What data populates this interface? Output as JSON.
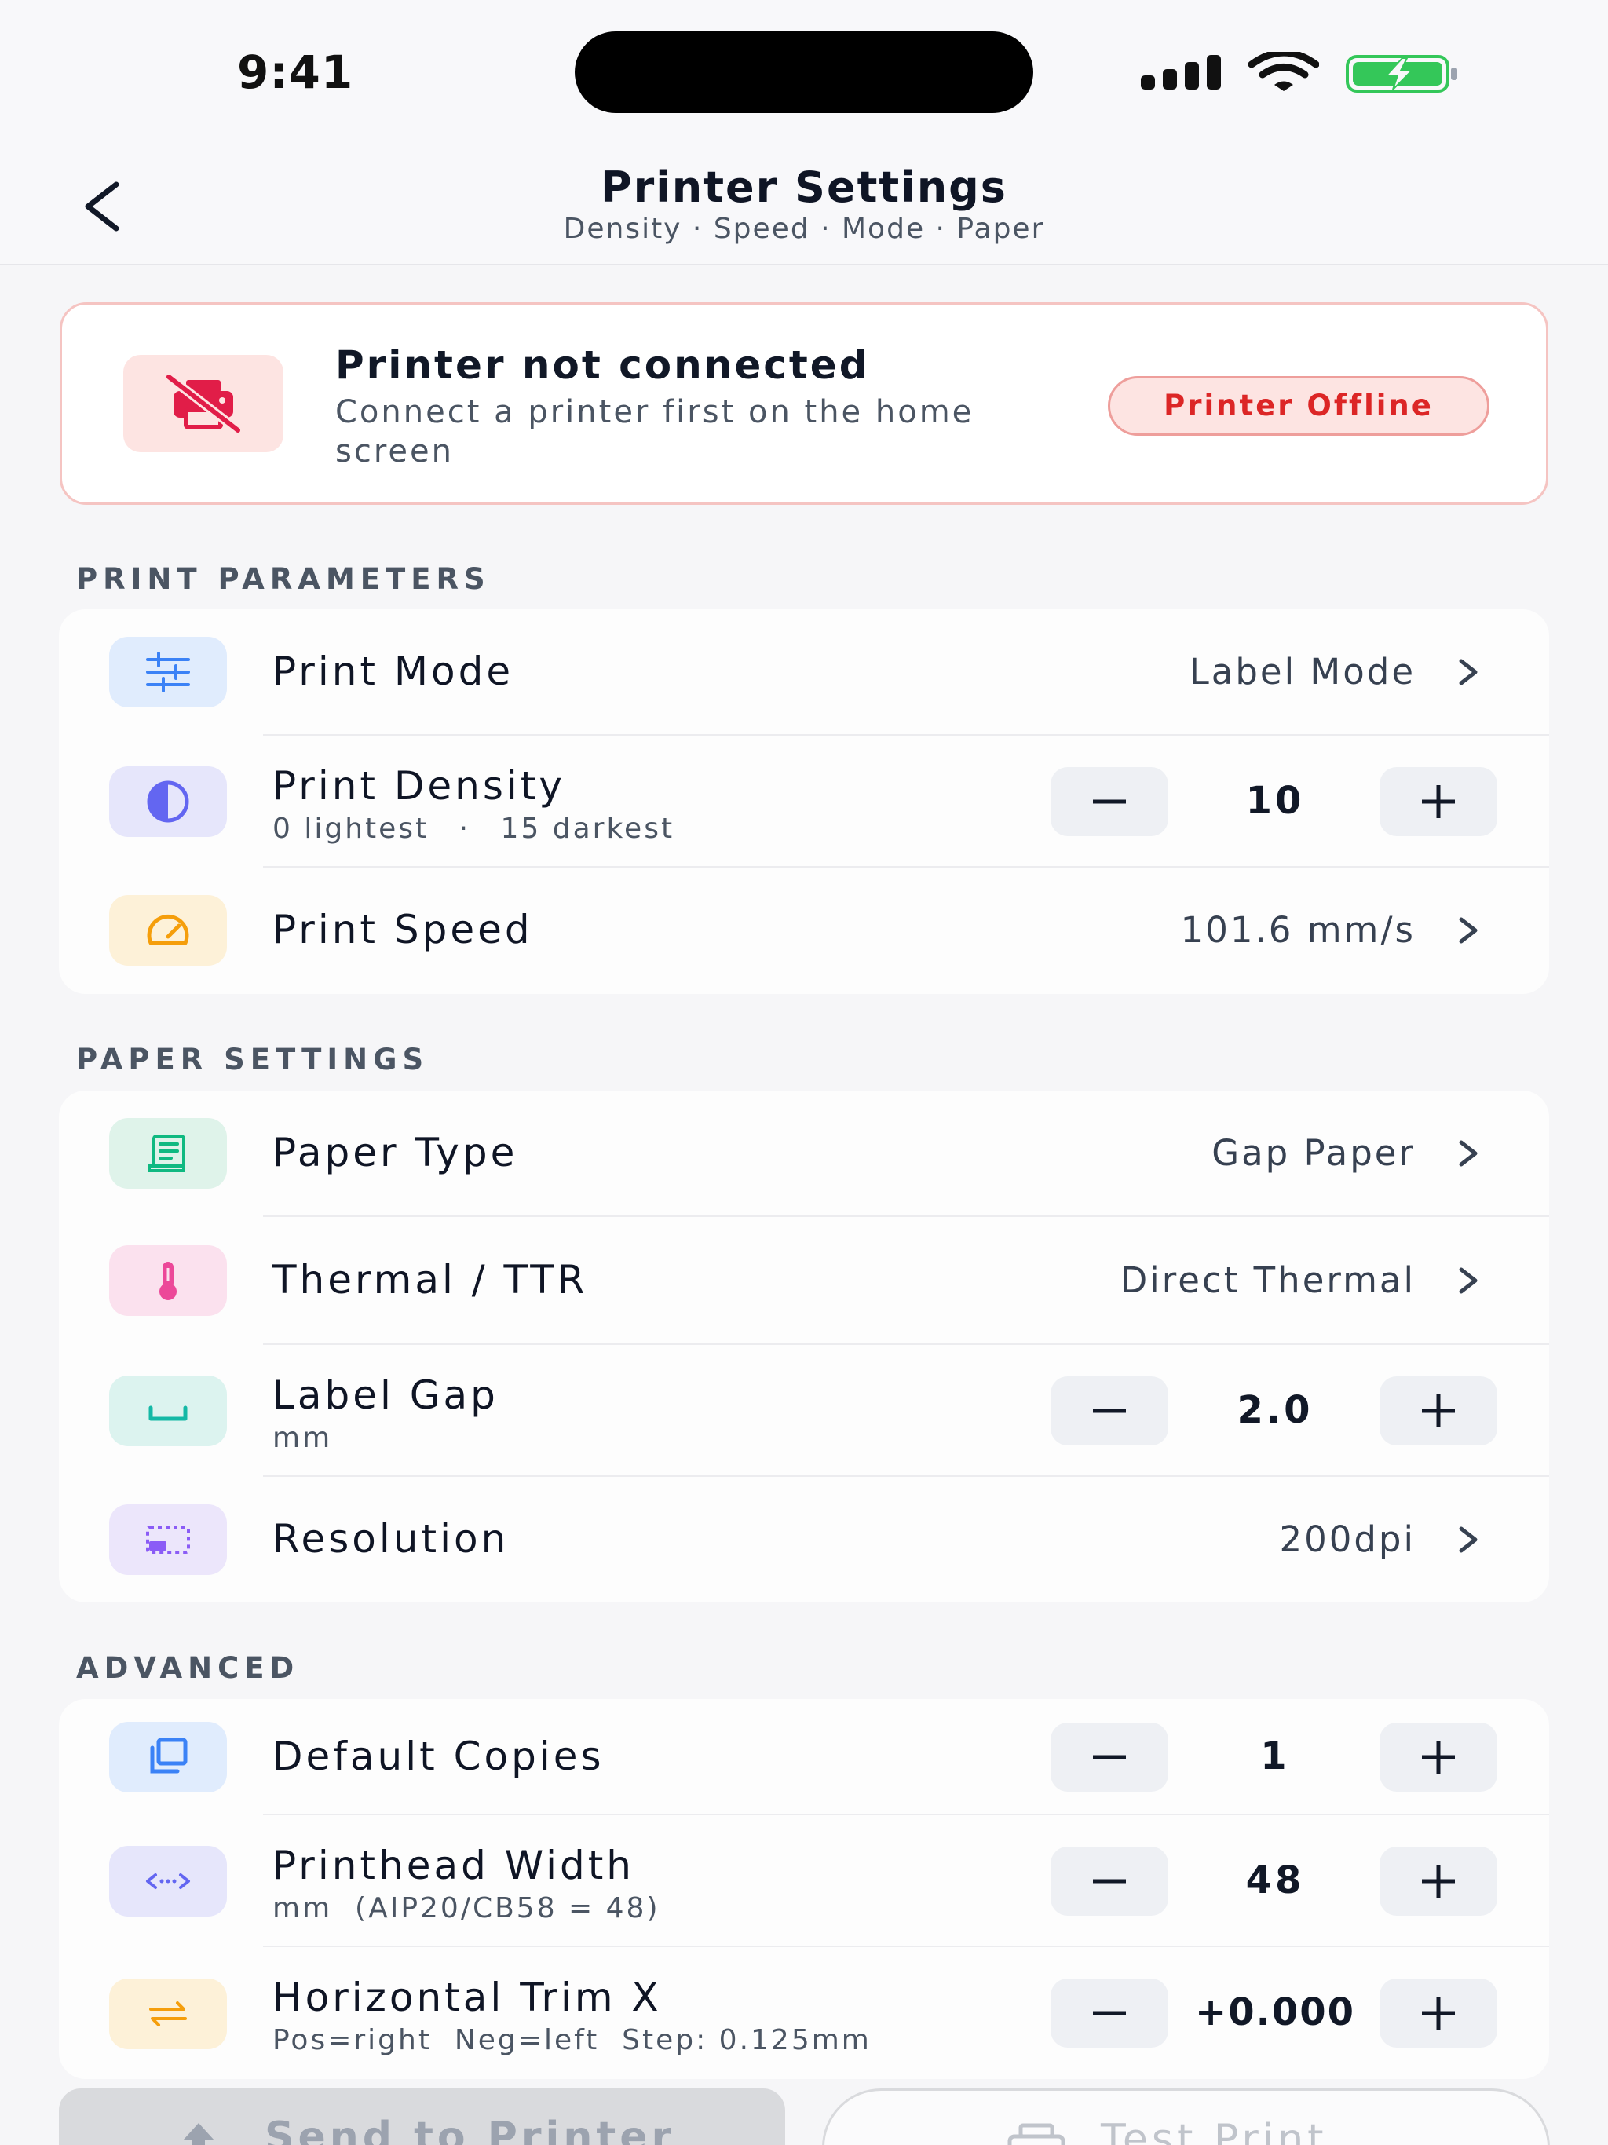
{
  "status_bar": {
    "time": "9:41"
  },
  "header": {
    "title": "Printer Settings",
    "subtitle": "Density · Speed · Mode · Paper"
  },
  "alert": {
    "title": "Printer not connected",
    "description": "Connect a printer first on the home screen",
    "badge": "Printer Offline",
    "icon": "printer-off-icon"
  },
  "sections": {
    "print_parameters": "PRINT PARAMETERS",
    "paper_settings": "PAPER SETTINGS",
    "advanced": "ADVANCED"
  },
  "print_parameters": {
    "mode": {
      "label": "Print Mode",
      "value": "Label Mode",
      "icon": "sliders-icon"
    },
    "density": {
      "label": "Print Density",
      "sub_left": "0 lightest",
      "sub_sep": "·",
      "sub_right": "15 darkest",
      "value": "10",
      "icon": "contrast-icon"
    },
    "speed": {
      "label": "Print Speed",
      "value": "101.6 mm/s",
      "icon": "speedometer-icon"
    }
  },
  "paper_settings": {
    "paper_type": {
      "label": "Paper Type",
      "value": "Gap Paper",
      "icon": "receipt-icon"
    },
    "thermal": {
      "label": "Thermal / TTR",
      "value": "Direct Thermal",
      "icon": "thermometer-icon"
    },
    "label_gap": {
      "label": "Label Gap",
      "sub": "mm",
      "value": "2.0",
      "icon": "gap-icon"
    },
    "resolution": {
      "label": "Resolution",
      "value": "200dpi",
      "icon": "resolution-icon"
    }
  },
  "advanced": {
    "copies": {
      "label": "Default Copies",
      "value": "1",
      "icon": "copies-icon"
    },
    "printhead_width": {
      "label": "Printhead Width",
      "sub": "mm  (AIP20/CB58 = 48)",
      "value": "48",
      "icon": "width-arrows-icon"
    },
    "trim_x": {
      "label": "Horizontal Trim X",
      "sub": "Pos=right  Neg=left  Step: 0.125mm",
      "value": "+0.000",
      "icon": "swap-arrows-icon"
    }
  },
  "stepper": {
    "minus": "—",
    "plus": "+"
  },
  "actions": {
    "send": "Send to Printer",
    "test": "Test Print"
  },
  "colors": {
    "danger": "#dc2626",
    "blue": "#3b82f6",
    "indigo": "#6366f1",
    "amber": "#f59e0b",
    "green": "#10b981",
    "pink": "#ec4899",
    "teal": "#14b8a6",
    "violet": "#8b5cf6",
    "battery": "#34c759"
  }
}
